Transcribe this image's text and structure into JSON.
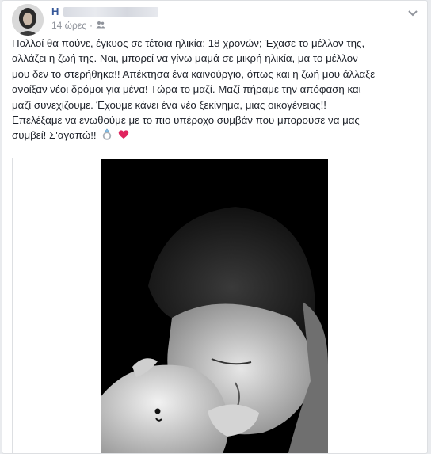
{
  "post": {
    "author_initial": "H",
    "timestamp": "14 ώρες",
    "privacy_icon": "friends-icon",
    "menu_icon": "chevron-down-icon",
    "text_lines": [
      "Πολλοί θα πούνε, έγκυος σε τέτοια ηλικία; 18 χρονών; Έχασε το μέλλον της,",
      "αλλάζει η ζωή της. Ναι, μπορεί να γίνω μαμά σε μικρή ηλικία, μα το μέλλον",
      "μου δεν το στερήθηκα!! Απέκτησα ένα καινούργιο, όπως και η ζωή μου άλλαξε",
      "ανοίξαν νέοι δρόμοι για μένα! Τώρα το μαζί. Μαζί πήραμε την απόφαση και",
      "μαζί συνεχίζουμε. Έχουμε κάνει ένα νέο ξεκίνημα, μιας οικογένειας!!",
      "Επελέξαμε να ενωθούμε με το πιο υπέροχο συμβάν που μπορούσε να μας",
      "συμβεί! Σ'αγαπώ!!"
    ],
    "emojis": [
      "ring-icon",
      "red-heart-icon"
    ],
    "photo_icon": "black-and-white-photo"
  }
}
